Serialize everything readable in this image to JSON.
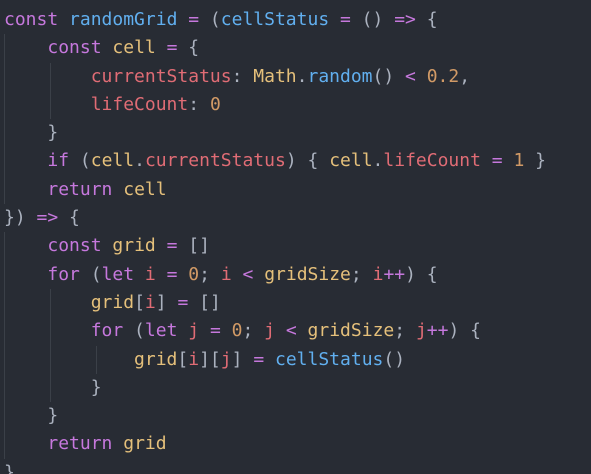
{
  "colors": {
    "background": "#282c34",
    "keyword": "#c678dd",
    "function": "#61afef",
    "variable": "#e5c07b",
    "property": "#e06c75",
    "number": "#d19a66",
    "punctuation": "#abb2bf",
    "operator": "#c678dd",
    "indent_guide": "#3b4048"
  },
  "lines": [
    {
      "indent": 0,
      "tokens": [
        {
          "t": "const",
          "c": "keyword"
        },
        {
          "t": " ",
          "c": "punctuation"
        },
        {
          "t": "randomGrid",
          "c": "function"
        },
        {
          "t": " ",
          "c": "punctuation"
        },
        {
          "t": "=",
          "c": "operator"
        },
        {
          "t": " (",
          "c": "punctuation"
        },
        {
          "t": "cellStatus",
          "c": "function"
        },
        {
          "t": " ",
          "c": "punctuation"
        },
        {
          "t": "=",
          "c": "operator"
        },
        {
          "t": " () ",
          "c": "punctuation"
        },
        {
          "t": "=>",
          "c": "keyword"
        },
        {
          "t": " {",
          "c": "punctuation"
        }
      ]
    },
    {
      "indent": 1,
      "tokens": [
        {
          "t": "const",
          "c": "keyword"
        },
        {
          "t": " ",
          "c": "punctuation"
        },
        {
          "t": "cell",
          "c": "variable"
        },
        {
          "t": " ",
          "c": "punctuation"
        },
        {
          "t": "=",
          "c": "operator"
        },
        {
          "t": " {",
          "c": "punctuation"
        }
      ]
    },
    {
      "indent": 2,
      "tokens": [
        {
          "t": "currentStatus",
          "c": "property"
        },
        {
          "t": ": ",
          "c": "punctuation"
        },
        {
          "t": "Math",
          "c": "variable"
        },
        {
          "t": ".",
          "c": "punctuation"
        },
        {
          "t": "random",
          "c": "function"
        },
        {
          "t": "() ",
          "c": "punctuation"
        },
        {
          "t": "<",
          "c": "operator"
        },
        {
          "t": " ",
          "c": "punctuation"
        },
        {
          "t": "0.2",
          "c": "number"
        },
        {
          "t": ",",
          "c": "punctuation"
        }
      ]
    },
    {
      "indent": 2,
      "tokens": [
        {
          "t": "lifeCount",
          "c": "property"
        },
        {
          "t": ": ",
          "c": "punctuation"
        },
        {
          "t": "0",
          "c": "number"
        }
      ]
    },
    {
      "indent": 1,
      "tokens": [
        {
          "t": "}",
          "c": "punctuation"
        }
      ]
    },
    {
      "indent": 1,
      "tokens": [
        {
          "t": "if",
          "c": "keyword"
        },
        {
          "t": " (",
          "c": "punctuation"
        },
        {
          "t": "cell",
          "c": "variable"
        },
        {
          "t": ".",
          "c": "punctuation"
        },
        {
          "t": "currentStatus",
          "c": "property"
        },
        {
          "t": ") { ",
          "c": "punctuation"
        },
        {
          "t": "cell",
          "c": "variable"
        },
        {
          "t": ".",
          "c": "punctuation"
        },
        {
          "t": "lifeCount",
          "c": "property"
        },
        {
          "t": " ",
          "c": "punctuation"
        },
        {
          "t": "=",
          "c": "operator"
        },
        {
          "t": " ",
          "c": "punctuation"
        },
        {
          "t": "1",
          "c": "number"
        },
        {
          "t": " }",
          "c": "punctuation"
        }
      ]
    },
    {
      "indent": 1,
      "tokens": [
        {
          "t": "return",
          "c": "keyword"
        },
        {
          "t": " ",
          "c": "punctuation"
        },
        {
          "t": "cell",
          "c": "variable"
        }
      ]
    },
    {
      "indent": 0,
      "tokens": [
        {
          "t": "}) ",
          "c": "punctuation"
        },
        {
          "t": "=>",
          "c": "keyword"
        },
        {
          "t": " {",
          "c": "punctuation"
        }
      ]
    },
    {
      "indent": 1,
      "tokens": [
        {
          "t": "const",
          "c": "keyword"
        },
        {
          "t": " ",
          "c": "punctuation"
        },
        {
          "t": "grid",
          "c": "variable"
        },
        {
          "t": " ",
          "c": "punctuation"
        },
        {
          "t": "=",
          "c": "operator"
        },
        {
          "t": " []",
          "c": "punctuation"
        }
      ]
    },
    {
      "indent": 1,
      "tokens": [
        {
          "t": "for",
          "c": "keyword"
        },
        {
          "t": " (",
          "c": "punctuation"
        },
        {
          "t": "let",
          "c": "keyword"
        },
        {
          "t": " ",
          "c": "punctuation"
        },
        {
          "t": "i",
          "c": "property"
        },
        {
          "t": " ",
          "c": "punctuation"
        },
        {
          "t": "=",
          "c": "operator"
        },
        {
          "t": " ",
          "c": "punctuation"
        },
        {
          "t": "0",
          "c": "number"
        },
        {
          "t": "; ",
          "c": "punctuation"
        },
        {
          "t": "i",
          "c": "property"
        },
        {
          "t": " ",
          "c": "punctuation"
        },
        {
          "t": "<",
          "c": "operator"
        },
        {
          "t": " ",
          "c": "punctuation"
        },
        {
          "t": "gridSize",
          "c": "variable"
        },
        {
          "t": "; ",
          "c": "punctuation"
        },
        {
          "t": "i",
          "c": "property"
        },
        {
          "t": "++",
          "c": "operator"
        },
        {
          "t": ") {",
          "c": "punctuation"
        }
      ]
    },
    {
      "indent": 2,
      "tokens": [
        {
          "t": "grid",
          "c": "variable"
        },
        {
          "t": "[",
          "c": "punctuation"
        },
        {
          "t": "i",
          "c": "property"
        },
        {
          "t": "] ",
          "c": "punctuation"
        },
        {
          "t": "=",
          "c": "operator"
        },
        {
          "t": " []",
          "c": "punctuation"
        }
      ]
    },
    {
      "indent": 2,
      "tokens": [
        {
          "t": "for",
          "c": "keyword"
        },
        {
          "t": " (",
          "c": "punctuation"
        },
        {
          "t": "let",
          "c": "keyword"
        },
        {
          "t": " ",
          "c": "punctuation"
        },
        {
          "t": "j",
          "c": "property"
        },
        {
          "t": " ",
          "c": "punctuation"
        },
        {
          "t": "=",
          "c": "operator"
        },
        {
          "t": " ",
          "c": "punctuation"
        },
        {
          "t": "0",
          "c": "number"
        },
        {
          "t": "; ",
          "c": "punctuation"
        },
        {
          "t": "j",
          "c": "property"
        },
        {
          "t": " ",
          "c": "punctuation"
        },
        {
          "t": "<",
          "c": "operator"
        },
        {
          "t": " ",
          "c": "punctuation"
        },
        {
          "t": "gridSize",
          "c": "variable"
        },
        {
          "t": "; ",
          "c": "punctuation"
        },
        {
          "t": "j",
          "c": "property"
        },
        {
          "t": "++",
          "c": "operator"
        },
        {
          "t": ") {",
          "c": "punctuation"
        }
      ]
    },
    {
      "indent": 3,
      "tokens": [
        {
          "t": "grid",
          "c": "variable"
        },
        {
          "t": "[",
          "c": "punctuation"
        },
        {
          "t": "i",
          "c": "property"
        },
        {
          "t": "][",
          "c": "punctuation"
        },
        {
          "t": "j",
          "c": "property"
        },
        {
          "t": "] ",
          "c": "punctuation"
        },
        {
          "t": "=",
          "c": "operator"
        },
        {
          "t": " ",
          "c": "punctuation"
        },
        {
          "t": "cellStatus",
          "c": "function"
        },
        {
          "t": "()",
          "c": "punctuation"
        }
      ]
    },
    {
      "indent": 2,
      "tokens": [
        {
          "t": "}",
          "c": "punctuation"
        }
      ]
    },
    {
      "indent": 1,
      "tokens": [
        {
          "t": "}",
          "c": "punctuation"
        }
      ]
    },
    {
      "indent": 1,
      "tokens": [
        {
          "t": "return",
          "c": "keyword"
        },
        {
          "t": " ",
          "c": "punctuation"
        },
        {
          "t": "grid",
          "c": "variable"
        }
      ]
    },
    {
      "indent": 0,
      "tokens": [
        {
          "t": "}",
          "c": "punctuation"
        }
      ]
    }
  ]
}
